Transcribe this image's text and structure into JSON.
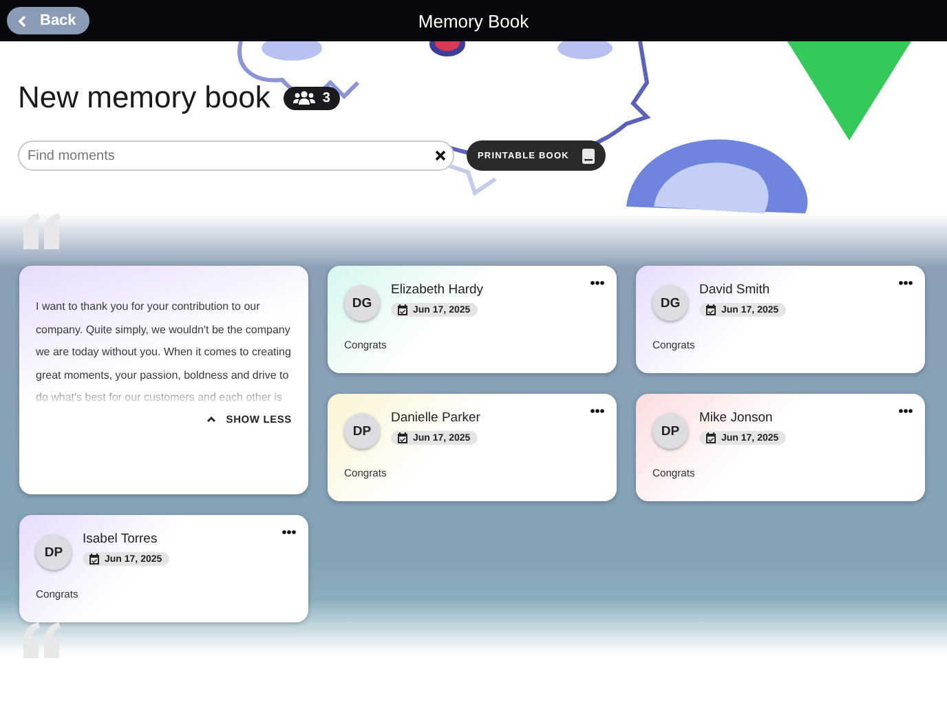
{
  "header": {
    "back_label": "Back",
    "title": "Memory Book"
  },
  "book": {
    "title": "New memory book",
    "members_count": "3"
  },
  "search": {
    "placeholder": "Find moments"
  },
  "printable_button": "PRINTABLE BOOK",
  "columns": [
    {
      "cards": [
        {
          "kind": "message",
          "color": "#e6dcfb",
          "text": "I want to thank you for your contribution to our company. Quite simply, we wouldn't be the company we are today without you. When it comes to creating great moments, your passion, boldness and drive to do what's best for our customers and each other is",
          "toggle": "SHOW LESS"
        },
        {
          "kind": "moment",
          "color": "#e6dcfb",
          "initials": "DP",
          "name": "Isabel Torres",
          "date": "Jun 17, 2025",
          "text": "Congrats"
        }
      ]
    },
    {
      "cards": [
        {
          "kind": "moment",
          "color": "#d6f6ef",
          "initials": "DG",
          "name": "Elizabeth Hardy",
          "date": "Jun 17, 2025",
          "text": "Congrats"
        },
        {
          "kind": "moment",
          "color": "#fbf3d2",
          "initials": "DP",
          "name": "Danielle Parker",
          "date": "Jun 17, 2025",
          "text": "Congrats"
        }
      ]
    },
    {
      "cards": [
        {
          "kind": "moment",
          "color": "#e6dcfb",
          "initials": "DG",
          "name": "David Smith",
          "date": "Jun 17, 2025",
          "text": "Congrats"
        },
        {
          "kind": "moment",
          "color": "#fadcde",
          "initials": "DP",
          "name": "Mike Jonson",
          "date": "Jun 17, 2025",
          "text": "Congrats"
        }
      ]
    }
  ]
}
